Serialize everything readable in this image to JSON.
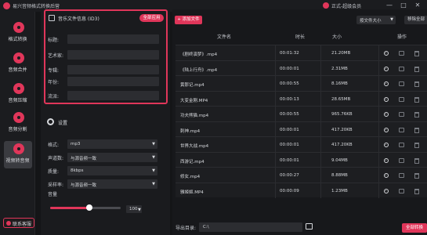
{
  "app": {
    "title": "易兴音频格式转换后营",
    "user": "正式-超级会员"
  },
  "window_controls": [
    "—",
    "□",
    "✕"
  ],
  "sidebar": {
    "items": [
      {
        "label": "格式转换",
        "icon": "disc-icon"
      },
      {
        "label": "音频合并",
        "icon": "disc-icon"
      },
      {
        "label": "音频压缩",
        "icon": "disc-icon"
      },
      {
        "label": "音频分割",
        "icon": "disc-icon"
      },
      {
        "label": "视频转音频",
        "icon": "disc-icon",
        "active": true
      }
    ],
    "support_label": "联系客服"
  },
  "tag_panel": {
    "title": "音乐文件信息 (ID3)",
    "apply_all": "全部应用",
    "fields": [
      {
        "label": "标题:",
        "value": ""
      },
      {
        "label": "艺术家:",
        "value": ""
      },
      {
        "label": "专辑:",
        "value": ""
      },
      {
        "label": "年份:",
        "value": ""
      },
      {
        "label": "流派:",
        "value": ""
      }
    ]
  },
  "settings": {
    "title": "设置",
    "rows": [
      {
        "label": "格式:",
        "value": "mp3"
      },
      {
        "label": "声道数:",
        "value": "与源音频一致"
      },
      {
        "label": "质量:",
        "value": "8kbps"
      },
      {
        "label": "采样率:",
        "value": "与源音频一致"
      }
    ],
    "volume_label": "音量",
    "volume_value": "100",
    "volume_level": 0.55
  },
  "toolbar": {
    "add_label": "+ 添加文件",
    "sort_value": "按文件大小",
    "clear_label": "移除全部"
  },
  "table": {
    "headers": [
      "文件名",
      "时长",
      "大小",
      "操作"
    ],
    "rows": [
      {
        "name": "《剧终演梦》.mp4",
        "duration": "00:01:32",
        "size": "21.20MB"
      },
      {
        "name": "《陆上行舟》.mp4",
        "duration": "00:00:01",
        "size": "2.31MB"
      },
      {
        "name": "黄那记.mp4",
        "duration": "00:00:55",
        "size": "8.16MB"
      },
      {
        "name": "大变金刚.MP4",
        "duration": "00:00:13",
        "size": "28.65MB"
      },
      {
        "name": "功夫熊猫.mp4",
        "duration": "00:00:55",
        "size": "965.76KB"
      },
      {
        "name": "刺神.mp4",
        "duration": "00:00:01",
        "size": "417.20KB"
      },
      {
        "name": "世界大战.mp4",
        "duration": "00:00:01",
        "size": "417.20KB"
      },
      {
        "name": "西游记.mp4",
        "duration": "00:00:01",
        "size": "9.04MB"
      },
      {
        "name": "修女.mp4",
        "duration": "00:00:27",
        "size": "8.88MB"
      },
      {
        "name": "雅姬姬.MP4",
        "duration": "00:00:09",
        "size": "1.23MB"
      }
    ]
  },
  "export": {
    "label": "导出目录:",
    "path": "C:\\",
    "convert_all": "全部转换"
  }
}
